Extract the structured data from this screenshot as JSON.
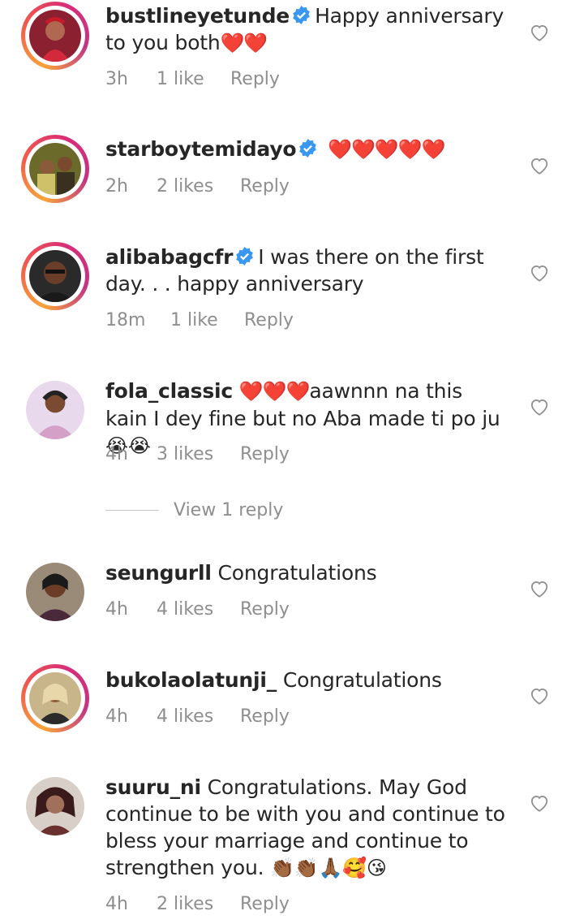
{
  "comments": [
    {
      "username": "bustlineyetunde",
      "verified": true,
      "text": "Happy anniversary to you both",
      "trailing_emoji": "❤️❤️",
      "time": "3h",
      "likes": "1 like",
      "reply": "Reply",
      "story_ring": true
    },
    {
      "username": "starboytemidayo",
      "verified": true,
      "text": "",
      "trailing_emoji": "❤️❤️❤️❤️❤️",
      "time": "2h",
      "likes": "2 likes",
      "reply": "Reply",
      "story_ring": true
    },
    {
      "username": "alibabagcfr",
      "verified": true,
      "text": "I was there on the first day. . . happy anniversary",
      "trailing_emoji": "",
      "time": "18m",
      "likes": "1 like",
      "reply": "Reply",
      "story_ring": true
    },
    {
      "username": "fola_classic",
      "verified": false,
      "leading_emoji": "❤️❤️❤️",
      "text": "aawnnn na this kain I dey fine but no Aba made ti po ju",
      "trailing_emoji": "😭😭",
      "time": "4h",
      "likes": "3 likes",
      "reply": "Reply",
      "story_ring": false
    },
    {
      "username": "seungurll",
      "verified": false,
      "text": "Congratulations",
      "trailing_emoji": "",
      "time": "4h",
      "likes": "4 likes",
      "reply": "Reply",
      "story_ring": false
    },
    {
      "username": "bukolaolatunji_",
      "verified": false,
      "text": "Congratulations",
      "trailing_emoji": "",
      "time": "4h",
      "likes": "4 likes",
      "reply": "Reply",
      "story_ring": true
    },
    {
      "username": "suuru_ni",
      "verified": false,
      "text": "Congratulations. May God continue to be with you and continue to bless your marriage and continue to strengthen you.",
      "trailing_emoji": "👏🏾👏🏾🙏🏾🥰😘",
      "time": "4h",
      "likes": "2 likes",
      "reply": "Reply",
      "story_ring": false
    }
  ],
  "view_replies_label": "View 1 reply",
  "icons": {
    "like": "heart-outline-icon",
    "verified": "verified-badge-icon"
  },
  "colors": {
    "verified_blue": "#3897f0",
    "heart_red": "#e0162b",
    "meta_gray": "#8e8e8e"
  }
}
